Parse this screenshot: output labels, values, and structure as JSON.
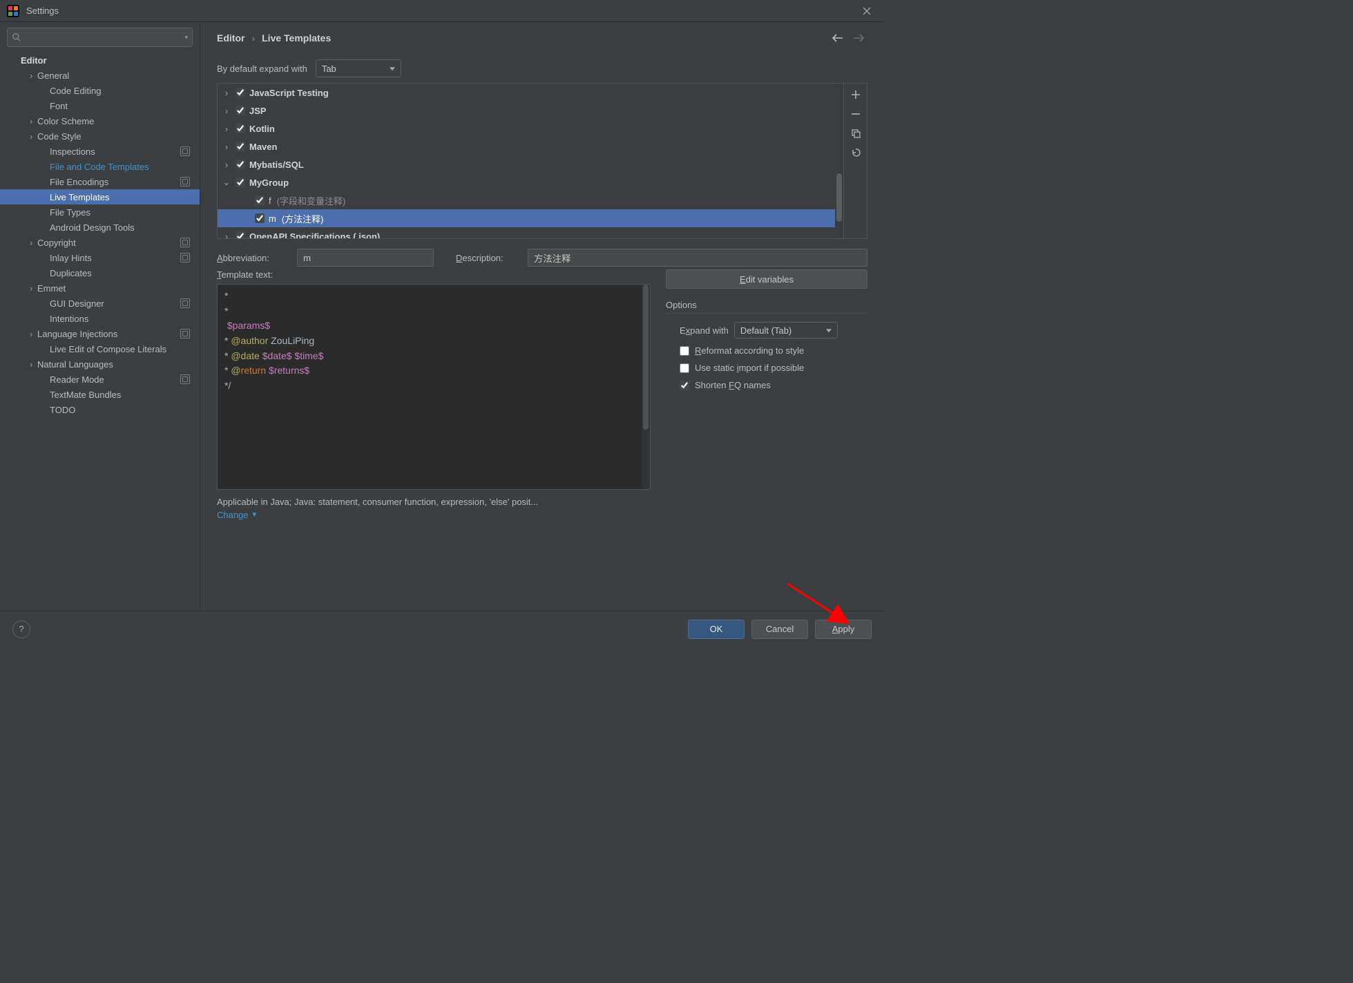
{
  "window": {
    "title": "Settings"
  },
  "breadcrumb": {
    "a": "Editor",
    "b": "Live Templates"
  },
  "nav": {
    "back_enabled": true,
    "fwd_enabled": false
  },
  "default_expand": {
    "label": "By default expand with",
    "value": "Tab"
  },
  "sidebar": {
    "header": "Editor",
    "items": [
      {
        "label": "General",
        "arrow": true,
        "depth": 1
      },
      {
        "label": "Code Editing",
        "depth": 2
      },
      {
        "label": "Font",
        "depth": 2
      },
      {
        "label": "Color Scheme",
        "arrow": true,
        "depth": 1
      },
      {
        "label": "Code Style",
        "arrow": true,
        "depth": 1
      },
      {
        "label": "Inspections",
        "depth": 2,
        "badge": true
      },
      {
        "label": "File and Code Templates",
        "depth": 2,
        "link": true
      },
      {
        "label": "File Encodings",
        "depth": 2,
        "badge": true
      },
      {
        "label": "Live Templates",
        "depth": 2,
        "active": true
      },
      {
        "label": "File Types",
        "depth": 2
      },
      {
        "label": "Android Design Tools",
        "depth": 2
      },
      {
        "label": "Copyright",
        "arrow": true,
        "depth": 1,
        "badge": true
      },
      {
        "label": "Inlay Hints",
        "depth": 2,
        "badge": true
      },
      {
        "label": "Duplicates",
        "depth": 2
      },
      {
        "label": "Emmet",
        "arrow": true,
        "depth": 1
      },
      {
        "label": "GUI Designer",
        "depth": 2,
        "badge": true
      },
      {
        "label": "Intentions",
        "depth": 2
      },
      {
        "label": "Language Injections",
        "arrow": true,
        "depth": 1,
        "badge": true
      },
      {
        "label": "Live Edit of Compose Literals",
        "depth": 2
      },
      {
        "label": "Natural Languages",
        "arrow": true,
        "depth": 1
      },
      {
        "label": "Reader Mode",
        "depth": 2,
        "badge": true
      },
      {
        "label": "TextMate Bundles",
        "depth": 2
      },
      {
        "label": "TODO",
        "depth": 2
      }
    ]
  },
  "groups": [
    {
      "label": "JavaScript Testing",
      "arrow": true,
      "checked": true
    },
    {
      "label": "JSP",
      "arrow": true,
      "checked": true
    },
    {
      "label": "Kotlin",
      "arrow": true,
      "checked": true
    },
    {
      "label": "Maven",
      "arrow": true,
      "checked": true
    },
    {
      "label": "Mybatis/SQL",
      "arrow": true,
      "checked": true
    },
    {
      "label": "MyGroup",
      "arrow": true,
      "expanded": true,
      "checked": true,
      "children": [
        {
          "label": "f",
          "desc": "(字段和变量注释)",
          "checked": true
        },
        {
          "label": "m",
          "desc": "(方法注释)",
          "checked": true,
          "selected": true
        }
      ]
    },
    {
      "label": "OpenAPI Specifications (.json)",
      "arrow": true,
      "checked": true
    }
  ],
  "form": {
    "abbr_label": "Abbreviation:",
    "abbr_value": "m",
    "desc_label": "Description:",
    "desc_value": "方法注释",
    "tpl_label": "Template text:",
    "edit_vars": "Edit variables",
    "options_title": "Options",
    "expand_label": "Expand with",
    "expand_value": "Default (Tab)",
    "opt_reformat": "Reformat according to style",
    "opt_static": "Use static import if possible",
    "opt_shorten": "Shorten FQ names",
    "opt_reformat_checked": false,
    "opt_static_checked": false,
    "opt_shorten_checked": true
  },
  "template_text": {
    "l1": "*",
    "l2": " * ",
    "l3_var": "$params$",
    "l4_a": " * ",
    "l4_at": "@author",
    "l4_b": " ZouLiPing",
    "l5_a": " * ",
    "l5_at": "@date",
    "l5_v1": " $date$",
    "l5_v2": " $time$",
    "l6_a": " * ",
    "l6_at": "@",
    "l6_kw": "return",
    "l6_v": " $returns$",
    "l7": " */"
  },
  "applicable": {
    "text": "Applicable in Java; Java: statement, consumer function, expression, 'else' posit...",
    "change": "Change"
  },
  "footer": {
    "ok": "OK",
    "cancel": "Cancel",
    "apply": "Apply"
  }
}
